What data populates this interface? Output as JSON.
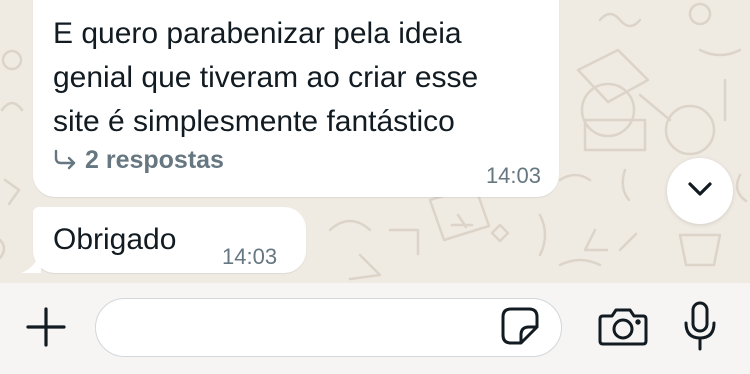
{
  "messages": [
    {
      "text": "E quero parabenizar pela ideia genial que tiveram ao criar esse site é simplesmente fantástico",
      "replies_label": "2 respostas",
      "time": "14:03"
    },
    {
      "text": "Obrigado",
      "time": "14:03"
    }
  ],
  "composer": {
    "placeholder": "",
    "value": ""
  },
  "icons": {
    "scroll_down": "chevron-down-icon",
    "plus": "plus-icon",
    "sticker": "sticker-icon",
    "camera": "camera-icon",
    "mic": "microphone-icon",
    "replies": "reply-arrow-icon"
  },
  "colors": {
    "chat_background": "#efeae2",
    "bubble": "#ffffff",
    "text": "#111b21",
    "meta_text": "#667781",
    "composer_bar": "#f6f5f3"
  }
}
